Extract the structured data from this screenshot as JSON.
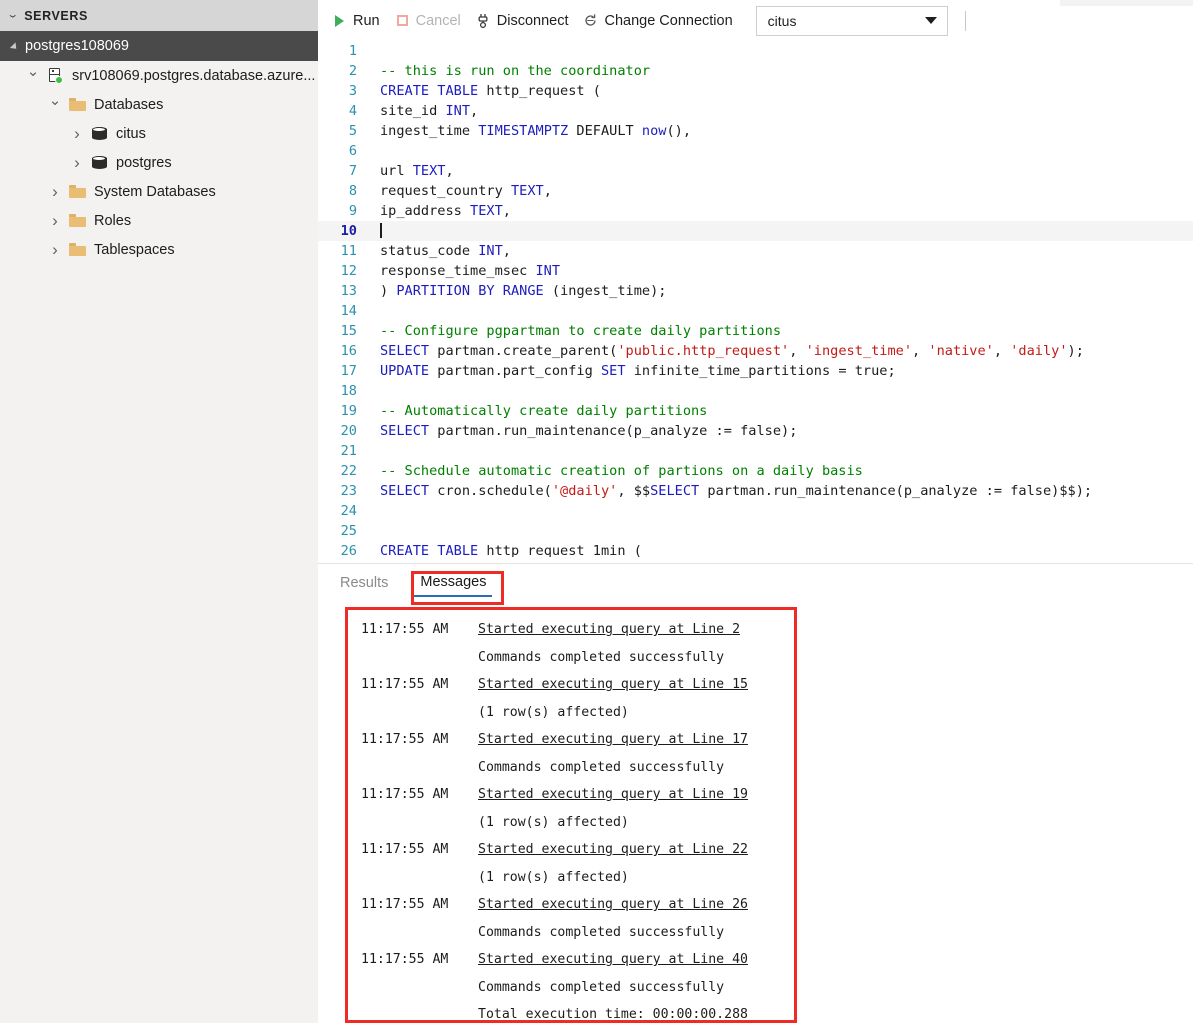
{
  "sidebar": {
    "header": {
      "label": "SERVERS",
      "chevron_icon": "chevron-down-icon"
    },
    "server_group": {
      "label": "postgres108069",
      "twisty_icon": "triangle-expanded-icon"
    },
    "tree": [
      {
        "label": "srv108069.postgres.database.azure...",
        "icon": "server-icon",
        "twisty": "⌄",
        "indent": 22,
        "expanded": true,
        "status_color": "#3ec13e"
      },
      {
        "label": "Databases",
        "icon": "folder-icon",
        "twisty": "⌄",
        "indent": 44,
        "expanded": true
      },
      {
        "label": "citus",
        "icon": "database-icon",
        "twisty": "›",
        "indent": 66,
        "expanded": false
      },
      {
        "label": "postgres",
        "icon": "database-icon",
        "twisty": "›",
        "indent": 66,
        "expanded": false
      },
      {
        "label": "System Databases",
        "icon": "folder-icon",
        "twisty": "›",
        "indent": 44,
        "expanded": false
      },
      {
        "label": "Roles",
        "icon": "folder-icon",
        "twisty": "›",
        "indent": 44,
        "expanded": false
      },
      {
        "label": "Tablespaces",
        "icon": "folder-icon",
        "twisty": "›",
        "indent": 44,
        "expanded": false
      }
    ]
  },
  "toolbar": {
    "run_label": "Run",
    "cancel_label": "Cancel",
    "disconnect_label": "Disconnect",
    "change_connection_label": "Change Connection",
    "connection_value": "citus",
    "icons": {
      "run": "play-icon",
      "cancel": "stop-square-icon",
      "disconnect": "unplug-icon",
      "change_connection": "refresh-connection-icon",
      "dropdown": "chevron-down-icon"
    }
  },
  "editor": {
    "current_line": 10,
    "lines": [
      {
        "n": 1,
        "segments": []
      },
      {
        "n": 2,
        "segments": [
          {
            "t": "-- this is run on the coordinator",
            "c": "cmt"
          }
        ]
      },
      {
        "n": 3,
        "segments": [
          {
            "t": "CREATE TABLE",
            "c": "kw"
          },
          {
            "t": " http_request (",
            "c": ""
          }
        ]
      },
      {
        "n": 4,
        "segments": [
          {
            "t": "site_id ",
            "c": ""
          },
          {
            "t": "INT",
            "c": "typ"
          },
          {
            "t": ",",
            "c": ""
          }
        ]
      },
      {
        "n": 5,
        "segments": [
          {
            "t": "ingest_time ",
            "c": ""
          },
          {
            "t": "TIMESTAMPTZ",
            "c": "typ"
          },
          {
            "t": " DEFAULT ",
            "c": ""
          },
          {
            "t": "now",
            "c": "fnc"
          },
          {
            "t": "(),",
            "c": ""
          }
        ]
      },
      {
        "n": 6,
        "segments": []
      },
      {
        "n": 7,
        "segments": [
          {
            "t": "url ",
            "c": ""
          },
          {
            "t": "TEXT",
            "c": "typ"
          },
          {
            "t": ",",
            "c": ""
          }
        ]
      },
      {
        "n": 8,
        "segments": [
          {
            "t": "request_country ",
            "c": ""
          },
          {
            "t": "TEXT",
            "c": "typ"
          },
          {
            "t": ",",
            "c": ""
          }
        ]
      },
      {
        "n": 9,
        "segments": [
          {
            "t": "ip_address ",
            "c": ""
          },
          {
            "t": "TEXT",
            "c": "typ"
          },
          {
            "t": ",",
            "c": ""
          }
        ]
      },
      {
        "n": 10,
        "segments": [],
        "caret": true
      },
      {
        "n": 11,
        "segments": [
          {
            "t": "status_code ",
            "c": ""
          },
          {
            "t": "INT",
            "c": "typ"
          },
          {
            "t": ",",
            "c": ""
          }
        ]
      },
      {
        "n": 12,
        "segments": [
          {
            "t": "response_time_msec ",
            "c": ""
          },
          {
            "t": "INT",
            "c": "typ"
          }
        ]
      },
      {
        "n": 13,
        "segments": [
          {
            "t": ") ",
            "c": ""
          },
          {
            "t": "PARTITION BY RANGE",
            "c": "kw"
          },
          {
            "t": " (ingest_time);",
            "c": ""
          }
        ]
      },
      {
        "n": 14,
        "segments": []
      },
      {
        "n": 15,
        "segments": [
          {
            "t": "-- Configure pgpartman to create daily partitions",
            "c": "cmt"
          }
        ]
      },
      {
        "n": 16,
        "segments": [
          {
            "t": "SELECT",
            "c": "kw"
          },
          {
            "t": " partman.create_parent(",
            "c": ""
          },
          {
            "t": "'public.http_request'",
            "c": "str"
          },
          {
            "t": ", ",
            "c": ""
          },
          {
            "t": "'ingest_time'",
            "c": "str"
          },
          {
            "t": ", ",
            "c": ""
          },
          {
            "t": "'native'",
            "c": "str"
          },
          {
            "t": ", ",
            "c": ""
          },
          {
            "t": "'daily'",
            "c": "str"
          },
          {
            "t": ");",
            "c": ""
          }
        ]
      },
      {
        "n": 17,
        "segments": [
          {
            "t": "UPDATE",
            "c": "kw"
          },
          {
            "t": " partman.part_config ",
            "c": ""
          },
          {
            "t": "SET",
            "c": "kw"
          },
          {
            "t": " infinite_time_partitions = true;",
            "c": ""
          }
        ]
      },
      {
        "n": 18,
        "segments": []
      },
      {
        "n": 19,
        "segments": [
          {
            "t": "-- Automatically create daily partitions",
            "c": "cmt"
          }
        ]
      },
      {
        "n": 20,
        "segments": [
          {
            "t": "SELECT",
            "c": "kw"
          },
          {
            "t": " partman.run_maintenance(p_analyze := false);",
            "c": ""
          }
        ]
      },
      {
        "n": 21,
        "segments": []
      },
      {
        "n": 22,
        "segments": [
          {
            "t": "-- Schedule automatic creation of partions on a daily basis",
            "c": "cmt"
          }
        ]
      },
      {
        "n": 23,
        "segments": [
          {
            "t": "SELECT",
            "c": "kw"
          },
          {
            "t": " cron.schedule(",
            "c": ""
          },
          {
            "t": "'@daily'",
            "c": "str"
          },
          {
            "t": ", $$",
            "c": ""
          },
          {
            "t": "SELECT",
            "c": "kw"
          },
          {
            "t": " partman.run_maintenance(p_analyze := false)$$);",
            "c": ""
          }
        ]
      },
      {
        "n": 24,
        "segments": []
      },
      {
        "n": 25,
        "segments": []
      },
      {
        "n": 26,
        "segments": [
          {
            "t": "CREATE TABLE",
            "c": "kw"
          },
          {
            "t": " http_request_1min (",
            "c": ""
          }
        ]
      }
    ]
  },
  "results": {
    "tabs": [
      {
        "label": "Results",
        "active": false
      },
      {
        "label": "Messages",
        "active": true
      }
    ],
    "messages": [
      {
        "time": "11:17:55 AM",
        "text": "Started executing query at Line 2",
        "link": true
      },
      {
        "time": "",
        "text": "Commands completed successfully",
        "link": false
      },
      {
        "time": "11:17:55 AM",
        "text": "Started executing query at Line 15",
        "link": true
      },
      {
        "time": "",
        "text": "(1 row(s) affected)",
        "link": false
      },
      {
        "time": "11:17:55 AM",
        "text": "Started executing query at Line 17",
        "link": true
      },
      {
        "time": "",
        "text": "Commands completed successfully",
        "link": false
      },
      {
        "time": "11:17:55 AM",
        "text": "Started executing query at Line 19",
        "link": true
      },
      {
        "time": "",
        "text": "(1 row(s) affected)",
        "link": false
      },
      {
        "time": "11:17:55 AM",
        "text": "Started executing query at Line 22",
        "link": true
      },
      {
        "time": "",
        "text": "(1 row(s) affected)",
        "link": false
      },
      {
        "time": "11:17:55 AM",
        "text": "Started executing query at Line 26",
        "link": true
      },
      {
        "time": "",
        "text": "Commands completed successfully",
        "link": false
      },
      {
        "time": "11:17:55 AM",
        "text": "Started executing query at Line 40",
        "link": true
      },
      {
        "time": "",
        "text": "Commands completed successfully",
        "link": false
      },
      {
        "time": "",
        "text": "Total execution time: 00:00:00.288",
        "link": false
      }
    ]
  },
  "annotations": {
    "highlight_color": "#ee2b24",
    "targets": [
      "messages-tab",
      "messages-output-box"
    ]
  }
}
